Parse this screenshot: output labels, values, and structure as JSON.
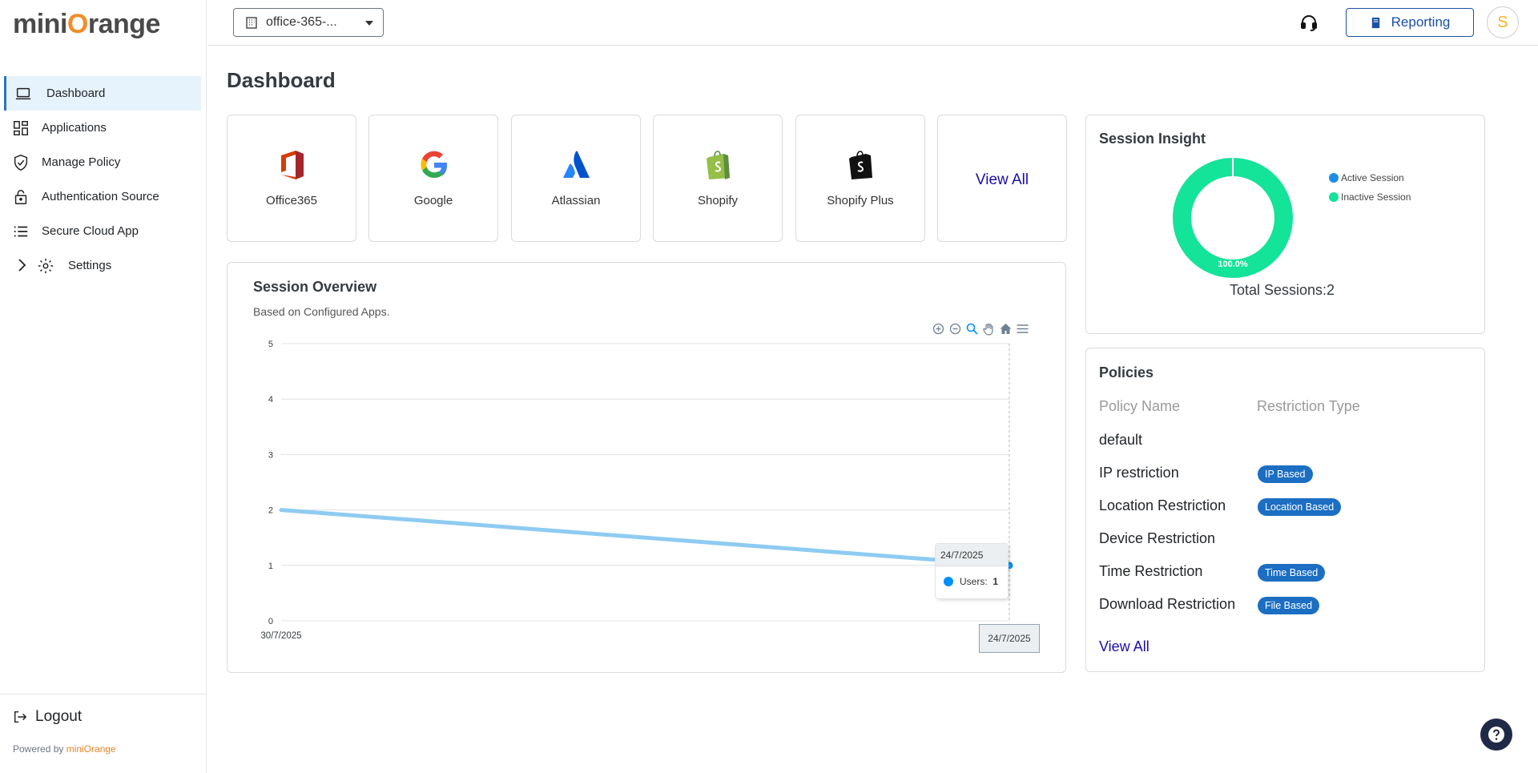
{
  "sidebar": {
    "logo": {
      "part1": "mini",
      "part2": "O",
      "part3": "range"
    },
    "items": [
      {
        "label": "Dashboard",
        "icon": "laptop-icon"
      },
      {
        "label": "Applications",
        "icon": "grid-icon"
      },
      {
        "label": "Manage Policy",
        "icon": "shield-icon"
      },
      {
        "label": "Authentication Source",
        "icon": "lock-icon"
      },
      {
        "label": "Secure Cloud App",
        "icon": "list-icon"
      },
      {
        "label": "Settings",
        "icon": "gear-icon"
      }
    ],
    "logout": "Logout",
    "powered_prefix": "Powered by ",
    "powered_brand": "miniOrange"
  },
  "header": {
    "org_select": "office-365-...",
    "reporting": "Reporting",
    "avatar_initial": "S"
  },
  "main": {
    "title": "Dashboard",
    "apps": [
      {
        "name": "Office365"
      },
      {
        "name": "Google"
      },
      {
        "name": "Atlassian"
      },
      {
        "name": "Shopify"
      },
      {
        "name": "Shopify Plus"
      }
    ],
    "apps_view_all": "View All"
  },
  "session_overview": {
    "title": "Session Overview",
    "subtitle": "Based on Configured Apps.",
    "tooltip": {
      "date": "24/7/2025",
      "series_label": "Users:",
      "value": "1"
    },
    "x_crosshair_label": "24/7/2025"
  },
  "chart_data": {
    "type": "line",
    "x": [
      "30/7/2025",
      "24/7/2025"
    ],
    "series": [
      {
        "name": "Users",
        "values": [
          2,
          1
        ]
      }
    ],
    "ylim": [
      0,
      5
    ],
    "yticks": [
      0,
      1,
      2,
      3,
      4,
      5
    ],
    "xticks": [
      "30/7/2025"
    ],
    "grid": true,
    "color": "#8ecbf2"
  },
  "session_insight": {
    "title": "Session Insight",
    "legend": [
      {
        "label": "Active Session",
        "color": "#1f8de8"
      },
      {
        "label": "Inactive Session",
        "color": "#14e39a"
      }
    ],
    "donut_label": "100.0%",
    "total": "Total Sessions:2",
    "donut_data": {
      "type": "pie",
      "slices": [
        {
          "name": "Active Session",
          "value": 0
        },
        {
          "name": "Inactive Session",
          "value": 100
        }
      ]
    }
  },
  "policies": {
    "title": "Policies",
    "col_name": "Policy Name",
    "col_type": "Restriction Type",
    "rows": [
      {
        "name": "default",
        "type": ""
      },
      {
        "name": "IP restriction",
        "type": "IP Based"
      },
      {
        "name": "Location Restriction",
        "type": "Location Based"
      },
      {
        "name": "Device Restriction",
        "type": ""
      },
      {
        "name": "Time Restriction",
        "type": "Time Based"
      },
      {
        "name": "Download Restriction",
        "type": "File Based"
      }
    ],
    "view_all": "View All"
  }
}
